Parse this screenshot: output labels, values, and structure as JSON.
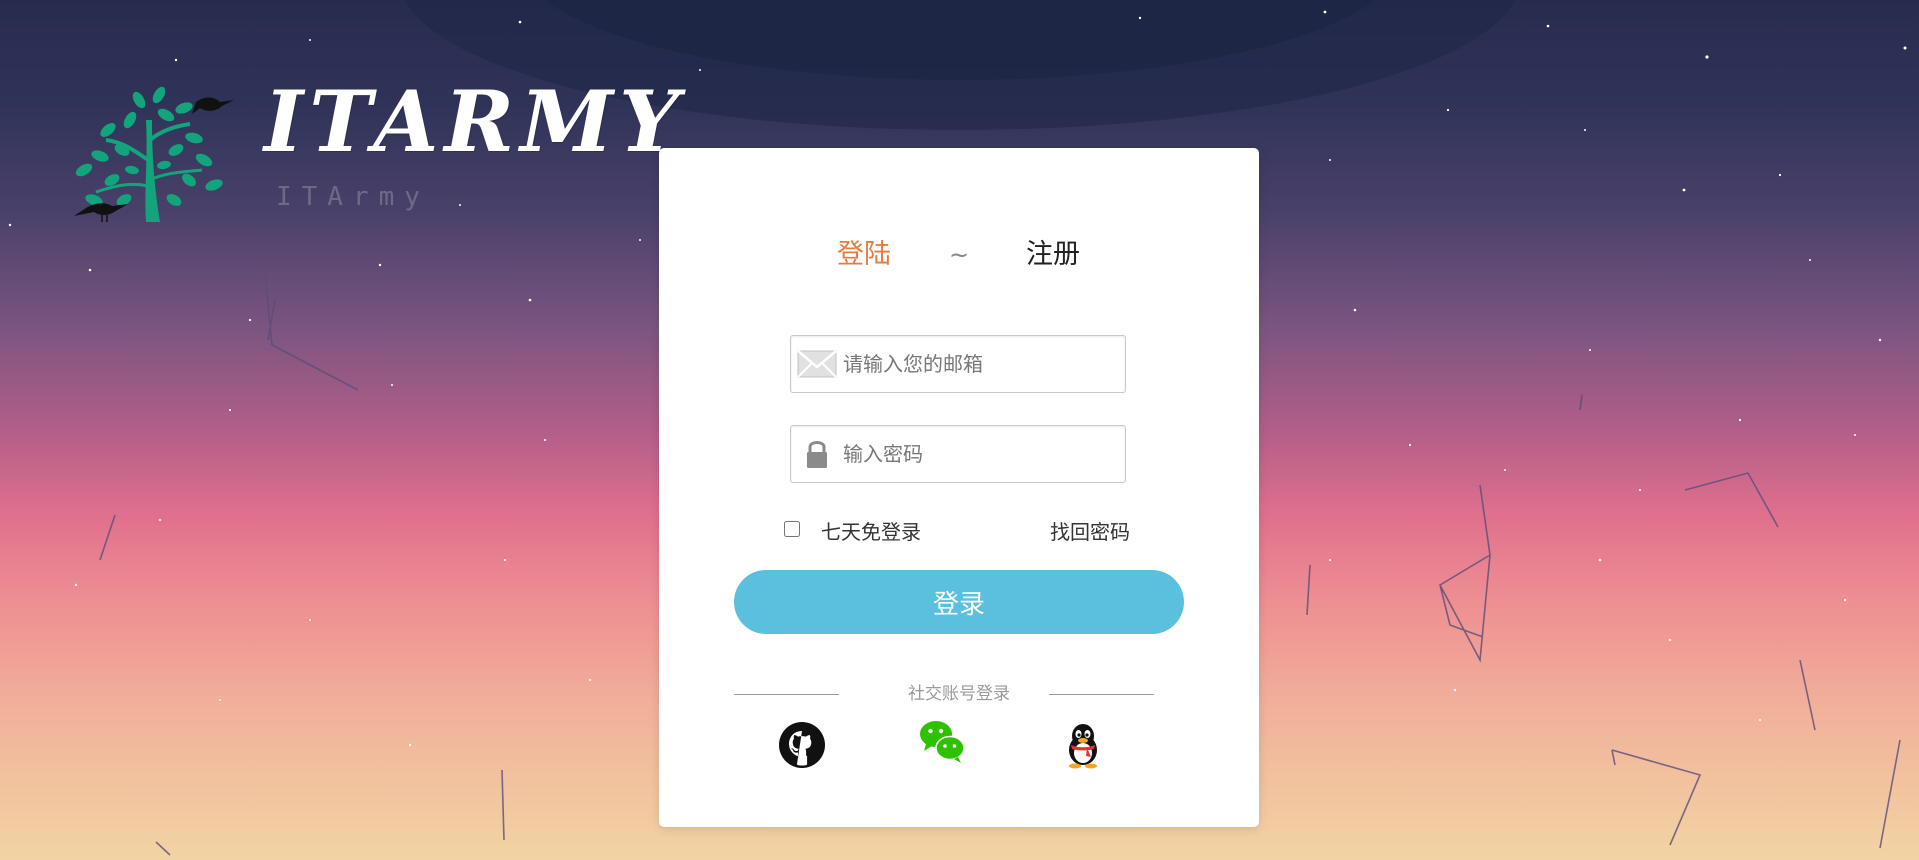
{
  "brand": {
    "name": "ITARMY",
    "subtitle": "ITArmy",
    "icon": "tree-with-birds-logo"
  },
  "auth_tabs": {
    "login_label": "登陆",
    "separator": "~",
    "register_label": "注册",
    "active": "login",
    "active_color": "#e97a3d"
  },
  "login_form": {
    "email_icon": "envelope-icon",
    "email_placeholder": "请输入您的邮箱",
    "email_value": "",
    "password_icon": "lock-icon",
    "password_placeholder": "输入密码",
    "password_value": "",
    "remember_label": "七天免登录",
    "remember_checked": false,
    "forgot_label": "找回密码",
    "submit_label": "登录",
    "submit_color": "#5bc0de"
  },
  "social_login": {
    "title": "社交账号登录",
    "providers": [
      {
        "name": "github",
        "icon": "github-icon"
      },
      {
        "name": "wechat",
        "icon": "wechat-icon"
      },
      {
        "name": "qq",
        "icon": "qq-penguin-icon"
      }
    ]
  }
}
